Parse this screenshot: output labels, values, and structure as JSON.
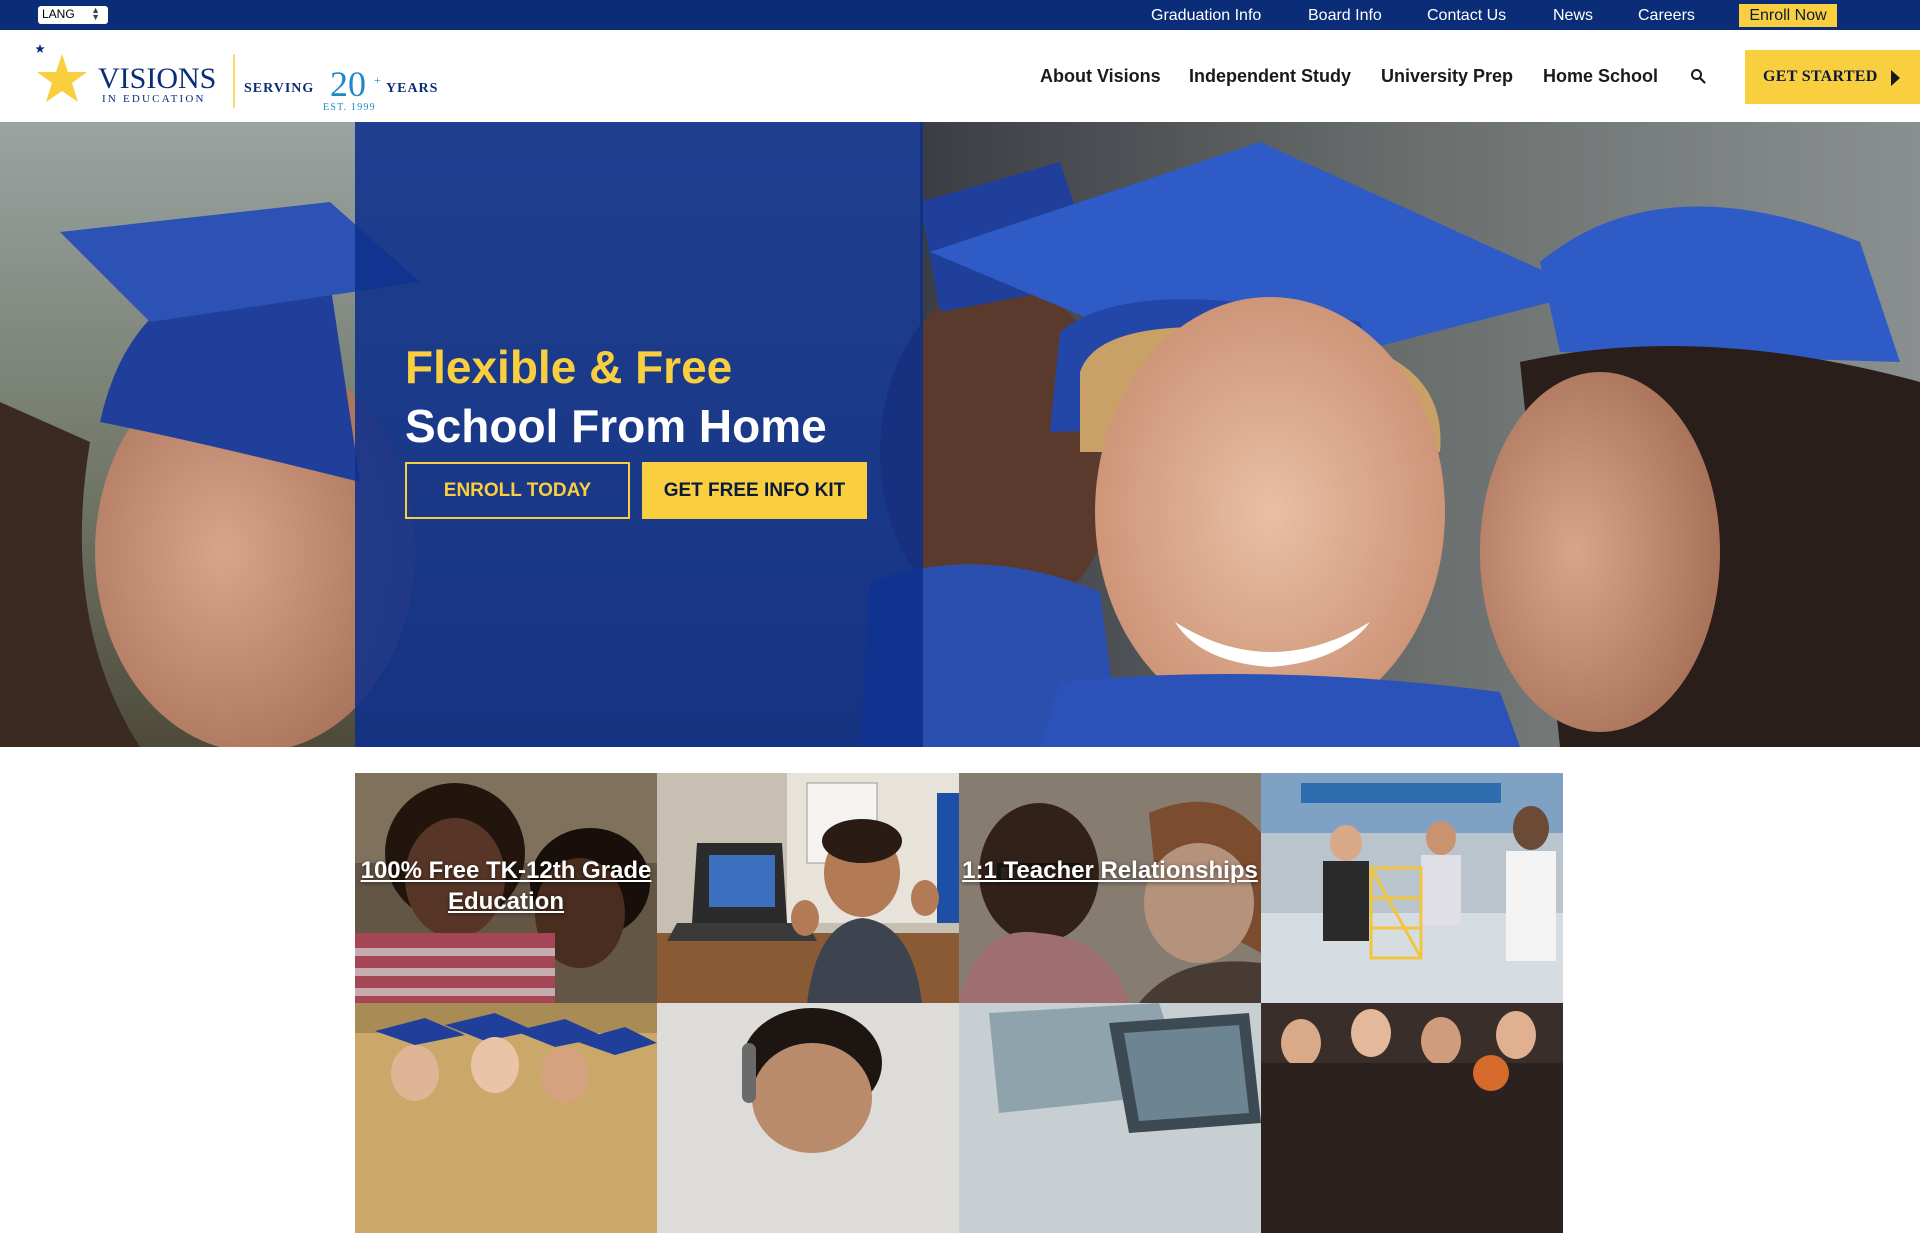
{
  "topbar": {
    "lang_label": "LANG",
    "links": [
      "Graduation Info",
      "Board Info",
      "Contact Us",
      "News",
      "Careers"
    ],
    "enroll_now": "Enroll Now"
  },
  "brand": {
    "name": "VISIONS",
    "sub": "IN EDUCATION",
    "serving": "SERVING",
    "years_num": "20",
    "years_plus": "+",
    "years_label": "YEARS",
    "est": "EST. 1999"
  },
  "nav": {
    "items": [
      "About Visions",
      "Independent Study",
      "University Prep",
      "Home School"
    ],
    "search_icon": "search-icon",
    "cta": "GET STARTED"
  },
  "hero": {
    "line1": "Flexible & Free",
    "line2": "School From Home",
    "enroll_button": "ENROLL TODAY",
    "kit_button": "GET FREE INFO KIT"
  },
  "tiles": {
    "t1": "100% Free TK-12th Grade Education",
    "t3": "1:1 Teacher Relationships"
  },
  "colors": {
    "navy": "#0b2d77",
    "yellow": "#f9cf3f",
    "hero_panel": "#0e308c"
  }
}
